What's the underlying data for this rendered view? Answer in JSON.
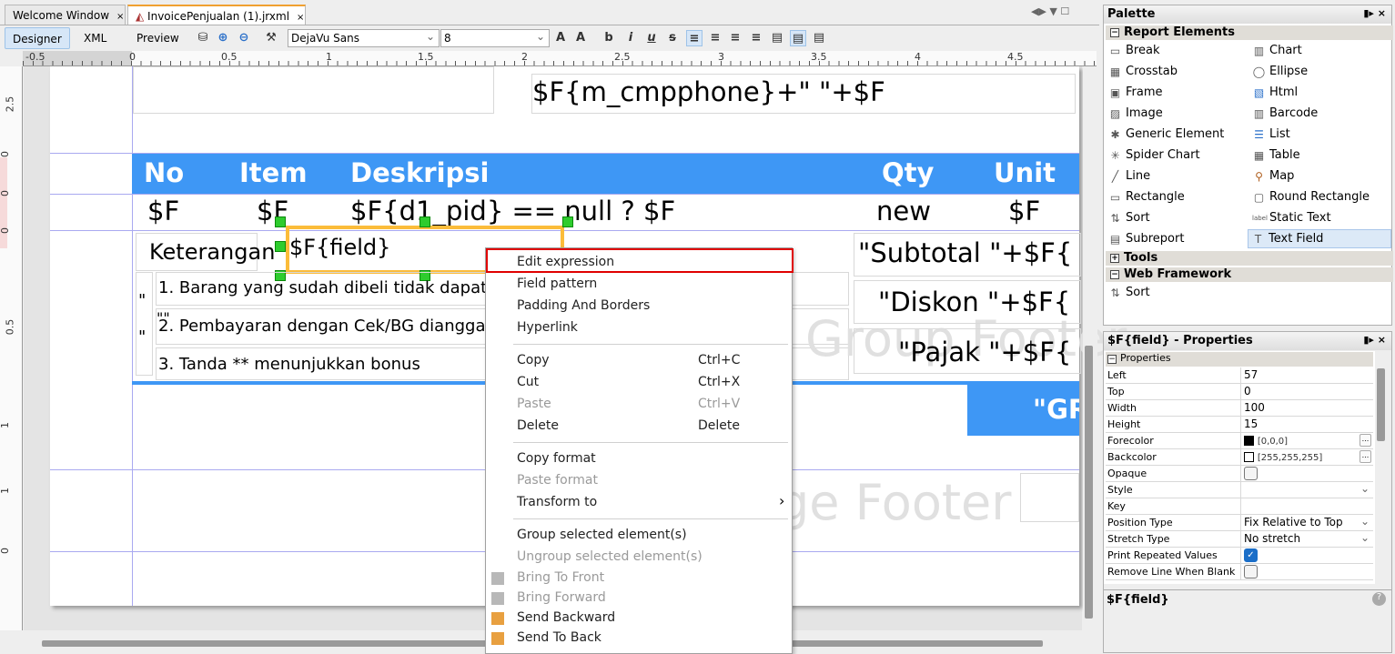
{
  "tabs": [
    {
      "label": "Welcome Window",
      "close": "×"
    },
    {
      "label": "InvoicePenjualan (1).jrxml",
      "close": "×"
    }
  ],
  "toolbar": {
    "designer": "Designer",
    "xml": "XML",
    "preview": "Preview",
    "font": "DejaVu Sans",
    "size": "8"
  },
  "ruler": {
    "h": [
      "-0.5",
      "0",
      "0.5",
      "1",
      "1.5",
      "2",
      "2.5",
      "3",
      "3.5",
      "4",
      "4.5"
    ],
    "v": [
      "2.5",
      "0",
      "0",
      "0",
      "0.5",
      "1",
      "1",
      "0"
    ]
  },
  "report": {
    "phone_expr": "$F{m_cmpphone}+\" \"+$F",
    "headers": [
      "No",
      "Item",
      "Deskripsi",
      "Qty",
      "Unit"
    ],
    "row": [
      "$F",
      "$F",
      "$F{d1_pid} == null ? $F",
      "new",
      "$F"
    ],
    "keterangan": "Keterangan",
    "field": "$F{field}",
    "quote1": "\"",
    "quote2": "\"\"",
    "quote3": "\"",
    "notes": [
      "1. Barang yang sudah dibeli tidak dapat d",
      "2. Pembayaran dengan Cek/BG dianggap",
      "3. Tanda ** menunjukkan bonus"
    ],
    "subtotal": "\"Subtotal \"+$F{",
    "diskon": "\"Diskon \"+$F{",
    "pajak": "\"Pajak \"+$F{",
    "grand": "\"GR",
    "group_footer": "Group Footer",
    "page_footer": "ge Footer",
    "header_color": "#3e97f5"
  },
  "context_menu": {
    "items": [
      {
        "label": "Edit expression",
        "highlighted": true
      },
      {
        "label": "Field pattern"
      },
      {
        "label": "Padding And Borders"
      },
      {
        "label": "Hyperlink"
      },
      {
        "label": "Copy",
        "shortcut": "Ctrl+C"
      },
      {
        "label": "Cut",
        "shortcut": "Ctrl+X"
      },
      {
        "label": "Paste",
        "shortcut": "Ctrl+V",
        "disabled": true
      },
      {
        "label": "Delete",
        "shortcut": "Delete"
      },
      {
        "label": "Copy format"
      },
      {
        "label": "Paste format",
        "disabled": true
      },
      {
        "label": "Transform to",
        "submenu": "›"
      },
      {
        "label": "Group selected element(s)"
      },
      {
        "label": "Ungroup selected element(s)",
        "disabled": true
      },
      {
        "label": "Bring To Front",
        "disabled": true
      },
      {
        "label": "Bring Forward",
        "disabled": true
      },
      {
        "label": "Send Backward"
      },
      {
        "label": "Send To Back"
      }
    ]
  },
  "palette": {
    "title": "Palette",
    "report_elements": "Report Elements",
    "items_left": [
      "Break",
      "Crosstab",
      "Frame",
      "Image",
      "Generic Element",
      "Spider Chart",
      "Line",
      "Rectangle",
      "Sort",
      "Subreport"
    ],
    "items_right": [
      "Chart",
      "Ellipse",
      "Html",
      "Barcode",
      "List",
      "Table",
      "Map",
      "Round Rectangle",
      "Static Text",
      "Text Field"
    ],
    "tools": "Tools",
    "web_framework": "Web Framework",
    "web_items": [
      "Sort"
    ]
  },
  "properties": {
    "title": "$F{field} - Properties",
    "section": "Properties",
    "rows": [
      {
        "key": "Left",
        "value": "57"
      },
      {
        "key": "Top",
        "value": "0"
      },
      {
        "key": "Width",
        "value": "100"
      },
      {
        "key": "Height",
        "value": "15"
      },
      {
        "key": "Forecolor",
        "value": "[0,0,0]",
        "swatch": "#000000"
      },
      {
        "key": "Backcolor",
        "value": "[255,255,255]",
        "swatch": "#ffffff"
      },
      {
        "key": "Opaque",
        "checked": false
      },
      {
        "key": "Style",
        "value": ""
      },
      {
        "key": "Key",
        "value": ""
      },
      {
        "key": "Position Type",
        "value": "Fix Relative to Top"
      },
      {
        "key": "Stretch Type",
        "value": "No stretch"
      },
      {
        "key": "Print Repeated Values",
        "checked": true
      },
      {
        "key": "Remove Line When Blank",
        "checked": false
      }
    ],
    "footer": "$F{field}"
  }
}
